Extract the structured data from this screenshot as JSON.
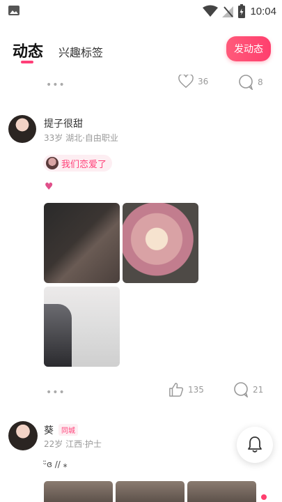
{
  "status_bar": {
    "time": "10:04"
  },
  "top_nav": {
    "tabs": [
      {
        "label": "动态"
      },
      {
        "label": "兴趣标签"
      }
    ],
    "post_button": "发动态"
  },
  "prev_post_actions": {
    "likes": "36",
    "comments": "8"
  },
  "post": {
    "user": {
      "name": "提子很甜",
      "meta": "33岁 湖北·自由职业"
    },
    "topic": "我们恋爱了",
    "text_emoji": "♥",
    "actions": {
      "likes": "135",
      "comments": "21"
    }
  },
  "next_post": {
    "user": {
      "name": "葵",
      "badge": "同城",
      "meta": "22岁 江西·护士"
    },
    "text": "ᵕ̈ɞ // ⁎"
  },
  "icons": [
    "photo-icon",
    "wifi-icon",
    "signal-icon",
    "battery-icon",
    "heart-icon",
    "comment-icon",
    "thumbs-up-icon",
    "bell-icon",
    "more-icon"
  ],
  "colors": {
    "accent": "#ff3f78"
  }
}
